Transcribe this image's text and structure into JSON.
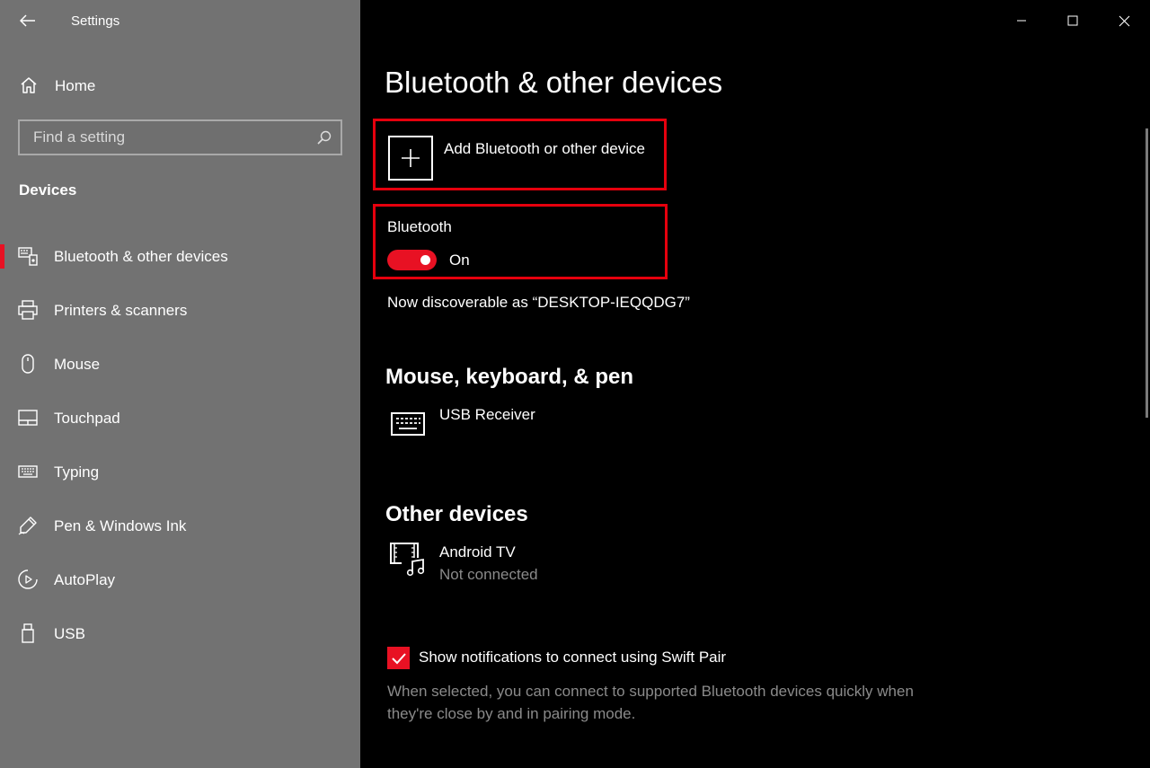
{
  "window": {
    "title": "Settings",
    "controls": [
      "minimize",
      "maximize",
      "close"
    ]
  },
  "sidebar": {
    "home_label": "Home",
    "search_placeholder": "Find a setting",
    "section_title": "Devices",
    "items": [
      {
        "label": "Bluetooth & other devices",
        "icon": "bluetooth-devices-icon",
        "active": true
      },
      {
        "label": "Printers & scanners",
        "icon": "printer-icon",
        "active": false
      },
      {
        "label": "Mouse",
        "icon": "mouse-icon",
        "active": false
      },
      {
        "label": "Touchpad",
        "icon": "touchpad-icon",
        "active": false
      },
      {
        "label": "Typing",
        "icon": "keyboard-icon",
        "active": false
      },
      {
        "label": "Pen & Windows Ink",
        "icon": "pen-icon",
        "active": false
      },
      {
        "label": "AutoPlay",
        "icon": "autoplay-icon",
        "active": false
      },
      {
        "label": "USB",
        "icon": "usb-icon",
        "active": false
      }
    ]
  },
  "main": {
    "title": "Bluetooth & other devices",
    "add_device_label": "Add Bluetooth or other device",
    "bluetooth": {
      "label": "Bluetooth",
      "state_label": "On",
      "on": true
    },
    "discoverable_text": "Now discoverable as “DESKTOP-IEQQDG7”",
    "mouse_section": {
      "heading": "Mouse, keyboard, & pen",
      "devices": [
        {
          "name": "USB Receiver",
          "icon": "keyboard-icon"
        }
      ]
    },
    "other_section": {
      "heading": "Other devices",
      "devices": [
        {
          "name": "Android TV",
          "status": "Not connected",
          "icon": "media-device-icon"
        }
      ]
    },
    "swift_pair": {
      "checked": true,
      "label": "Show notifications to connect using Swift Pair",
      "description": "When selected, you can connect to supported Bluetooth devices quickly when they're close by and in pairing mode."
    }
  },
  "colors": {
    "sidebar_bg": "#727272",
    "main_bg": "#000000",
    "accent": "#e81123",
    "highlight_box": "#e5000d",
    "secondary_text": "#8a8a8a"
  }
}
